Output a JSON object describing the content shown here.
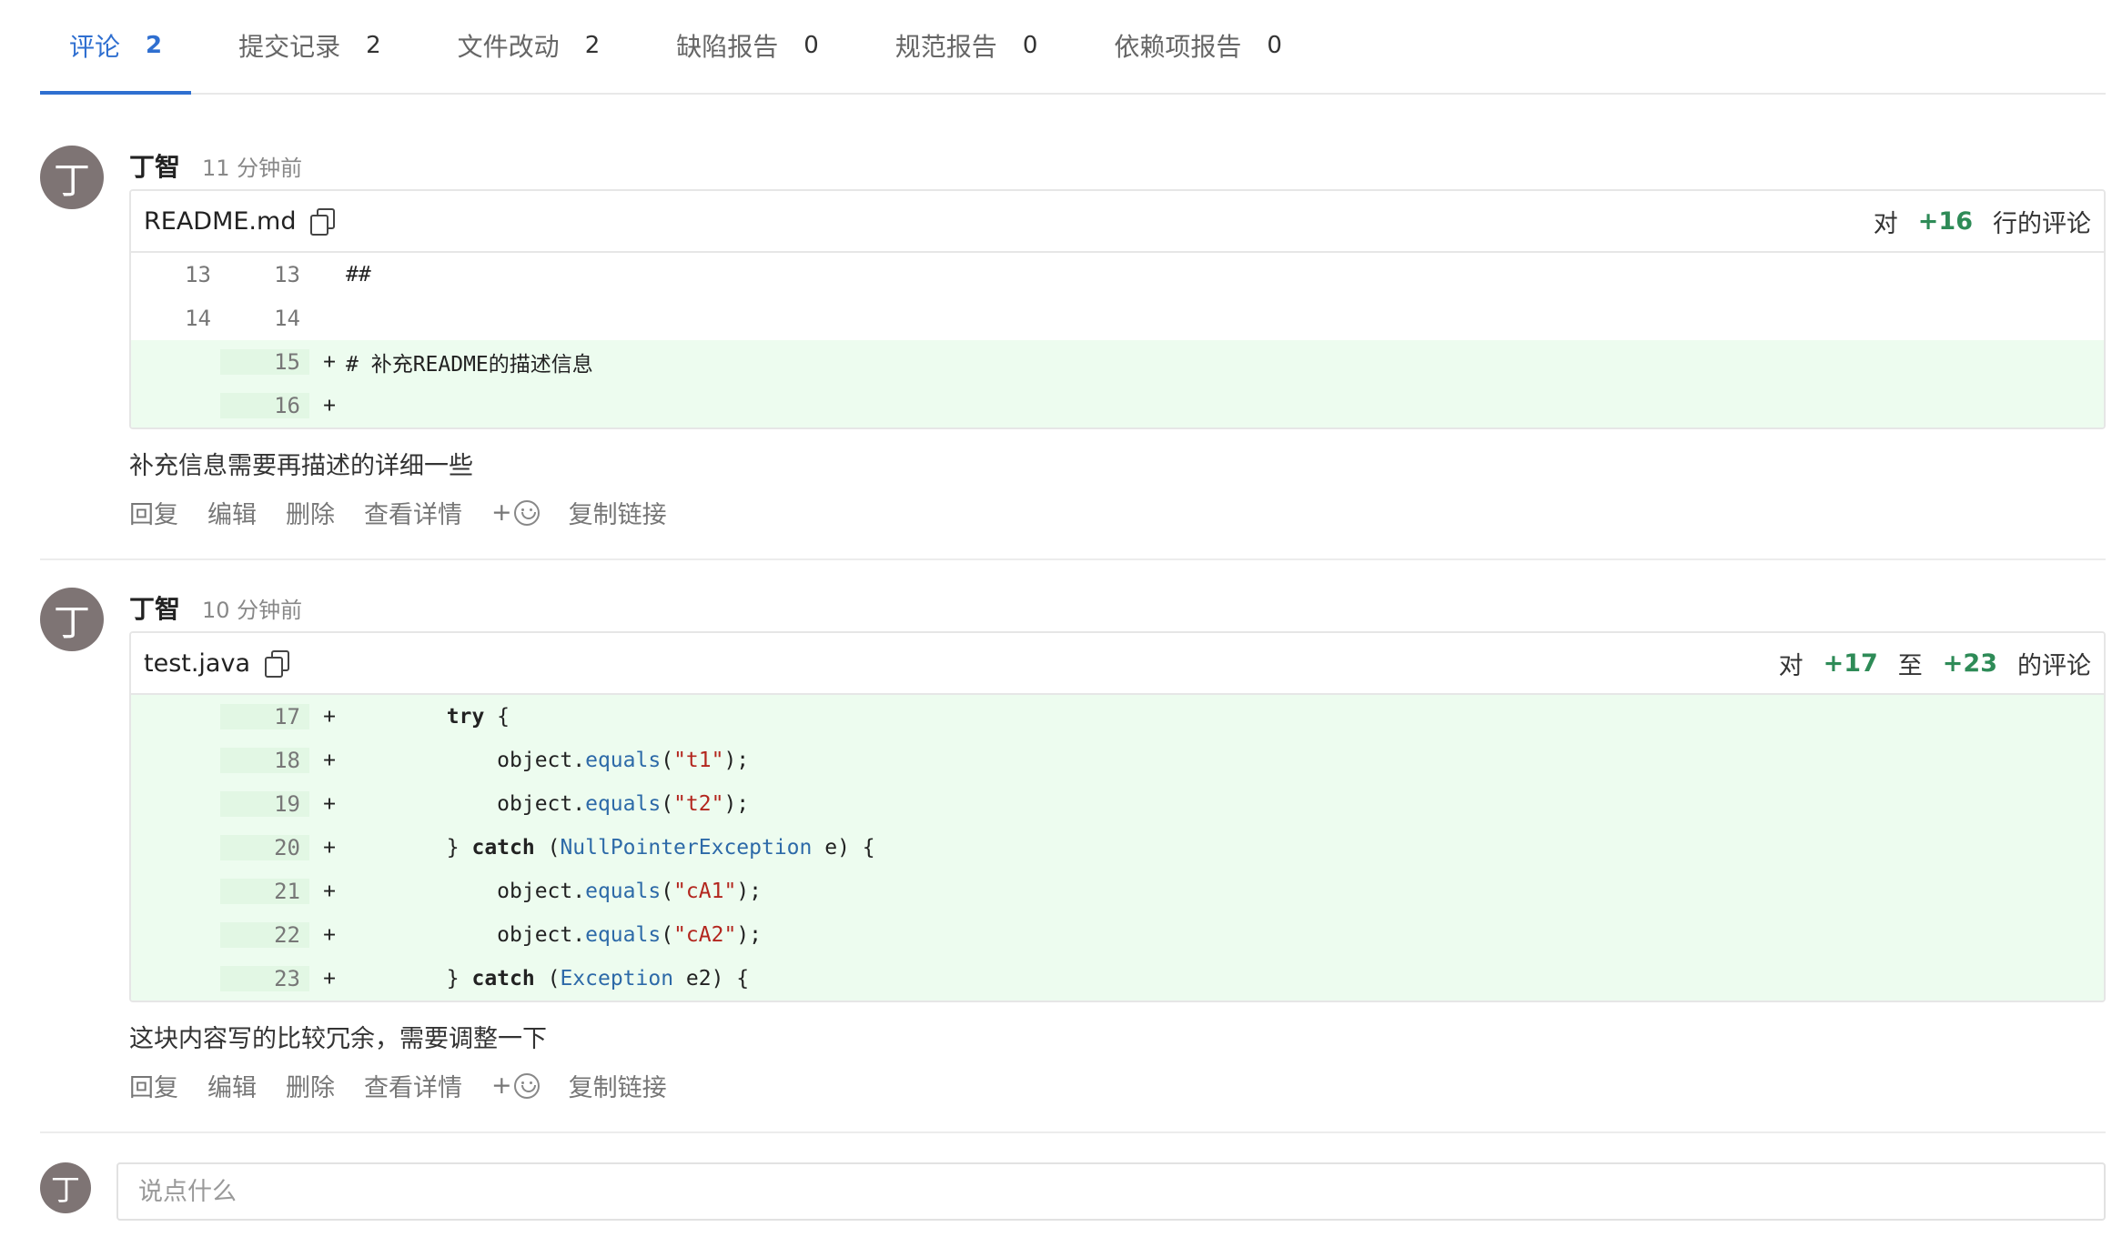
{
  "tabs": [
    {
      "label": "评论",
      "count": "2",
      "active": true
    },
    {
      "label": "提交记录",
      "count": "2"
    },
    {
      "label": "文件改动",
      "count": "2"
    },
    {
      "label": "缺陷报告",
      "count": "0"
    },
    {
      "label": "规范报告",
      "count": "0"
    },
    {
      "label": "依赖项报告",
      "count": "0"
    }
  ],
  "comments": [
    {
      "avatar": "丁",
      "author": "丁智",
      "time": "11 分钟前",
      "file": "README.md",
      "ref_prefix": "对",
      "ref_start": "+16",
      "ref_suffix": "行的评论",
      "lines": [
        {
          "old": "13",
          "new": "13",
          "sign": "",
          "code": "##"
        },
        {
          "old": "14",
          "new": "14",
          "sign": "",
          "code": ""
        },
        {
          "old": "",
          "new": "15",
          "sign": "+",
          "code": "# 补充README的描述信息"
        },
        {
          "old": "",
          "new": "16",
          "sign": "+",
          "code": ""
        }
      ],
      "text": "补充信息需要再描述的详细一些"
    },
    {
      "avatar": "丁",
      "author": "丁智",
      "time": "10 分钟前",
      "file": "test.java",
      "ref_prefix": "对",
      "ref_start": "+17",
      "ref_mid": "至",
      "ref_end": "+23",
      "ref_suffix": "的评论",
      "lines": [
        {
          "new": "17",
          "sign": "+",
          "indent": "        ",
          "kw": "try",
          "rest": " {"
        },
        {
          "new": "18",
          "sign": "+",
          "obj": "            object.",
          "fn": "equals",
          "str": "\"t1\"",
          "tail": ");"
        },
        {
          "new": "19",
          "sign": "+",
          "obj": "            object.",
          "fn": "equals",
          "str": "\"t2\"",
          "tail": ");"
        },
        {
          "new": "20",
          "sign": "+",
          "pre": "        } ",
          "kw": "catch",
          "cls": "NullPointerException",
          "post": " e) {"
        },
        {
          "new": "21",
          "sign": "+",
          "obj": "            object.",
          "fn": "equals",
          "str": "\"cA1\"",
          "tail": ");"
        },
        {
          "new": "22",
          "sign": "+",
          "obj": "            object.",
          "fn": "equals",
          "str": "\"cA2\"",
          "tail": ");"
        },
        {
          "new": "23",
          "sign": "+",
          "pre": "        } ",
          "kw": "catch",
          "cls": "Exception",
          "post": " e2) {"
        }
      ],
      "text": "这块内容写的比较冗余，需要调整一下"
    }
  ],
  "actions": {
    "reply": "回复",
    "edit": "编辑",
    "delete": "删除",
    "detail": "查看详情",
    "plus": "+",
    "copy_link": "复制链接"
  },
  "composer": {
    "avatar": "丁",
    "placeholder": "说点什么"
  }
}
